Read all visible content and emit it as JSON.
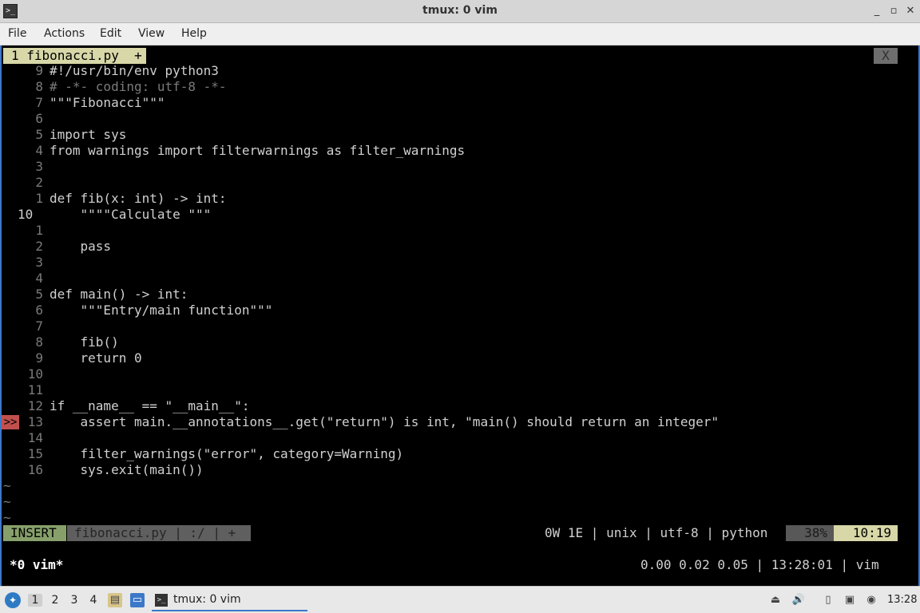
{
  "window": {
    "title": "tmux: 0 vim",
    "app_icon": "terminal-icon",
    "controls": [
      "minimize",
      "maximize",
      "close"
    ]
  },
  "menu": [
    "File",
    "Actions",
    "Edit",
    "View",
    "Help"
  ],
  "vim": {
    "tab_label": "1 fibonacci.py  +",
    "tab_close": "X",
    "lines": [
      {
        "num": "9",
        "text": "#!/usr/bin/env python3"
      },
      {
        "num": "8",
        "text": "# -*- coding: utf-8 -*-"
      },
      {
        "num": "7",
        "text": "\"\"\"Fibonacci\"\"\""
      },
      {
        "num": "6",
        "text": ""
      },
      {
        "num": "5",
        "text": "import sys"
      },
      {
        "num": "4",
        "text": "from warnings import filterwarnings as filter_warnings"
      },
      {
        "num": "3",
        "text": ""
      },
      {
        "num": "2",
        "text": ""
      },
      {
        "num": "1",
        "text": "def fib(x: int) -> int:"
      },
      {
        "num": "10",
        "text": "    \"\"\"\"Calculate \"\"\""
      },
      {
        "num": "1",
        "text": ""
      },
      {
        "num": "2",
        "text": "    pass"
      },
      {
        "num": "3",
        "text": ""
      },
      {
        "num": "4",
        "text": ""
      },
      {
        "num": "5",
        "text": "def main() -> int:"
      },
      {
        "num": "6",
        "text": "    \"\"\"Entry/main function\"\"\""
      },
      {
        "num": "7",
        "text": ""
      },
      {
        "num": "8",
        "text": "    fib()"
      },
      {
        "num": "9",
        "text": "    return 0"
      },
      {
        "num": "10",
        "text": ""
      },
      {
        "num": "11",
        "text": ""
      },
      {
        "num": "12",
        "text": "if __name__ == \"__main__\":"
      },
      {
        "num": "13",
        "text": "    assert main.__annotations__.get(\"return\") is int, \"main() should return an integer\""
      },
      {
        "num": "14",
        "text": ""
      },
      {
        "num": "15",
        "text": "    filter_warnings(\"error\", category=Warning)"
      },
      {
        "num": "16",
        "text": "    sys.exit(main())"
      }
    ],
    "sign_marker": ">>",
    "tilde": "~",
    "status": {
      "mode": "INSERT",
      "file": "fibonacci.py | :/ | +",
      "info": "0W 1E | unix | utf-8 | python",
      "percent": "38%",
      "position": "10:19"
    }
  },
  "tmux": {
    "window": "*0 vim*",
    "right": "0.00 0.02 0.05 | 13:28:01 | vim"
  },
  "taskbar": {
    "workspaces": [
      "1",
      "2",
      "3",
      "4"
    ],
    "task_label": "tmux: 0 vim",
    "clock": "13:28"
  }
}
